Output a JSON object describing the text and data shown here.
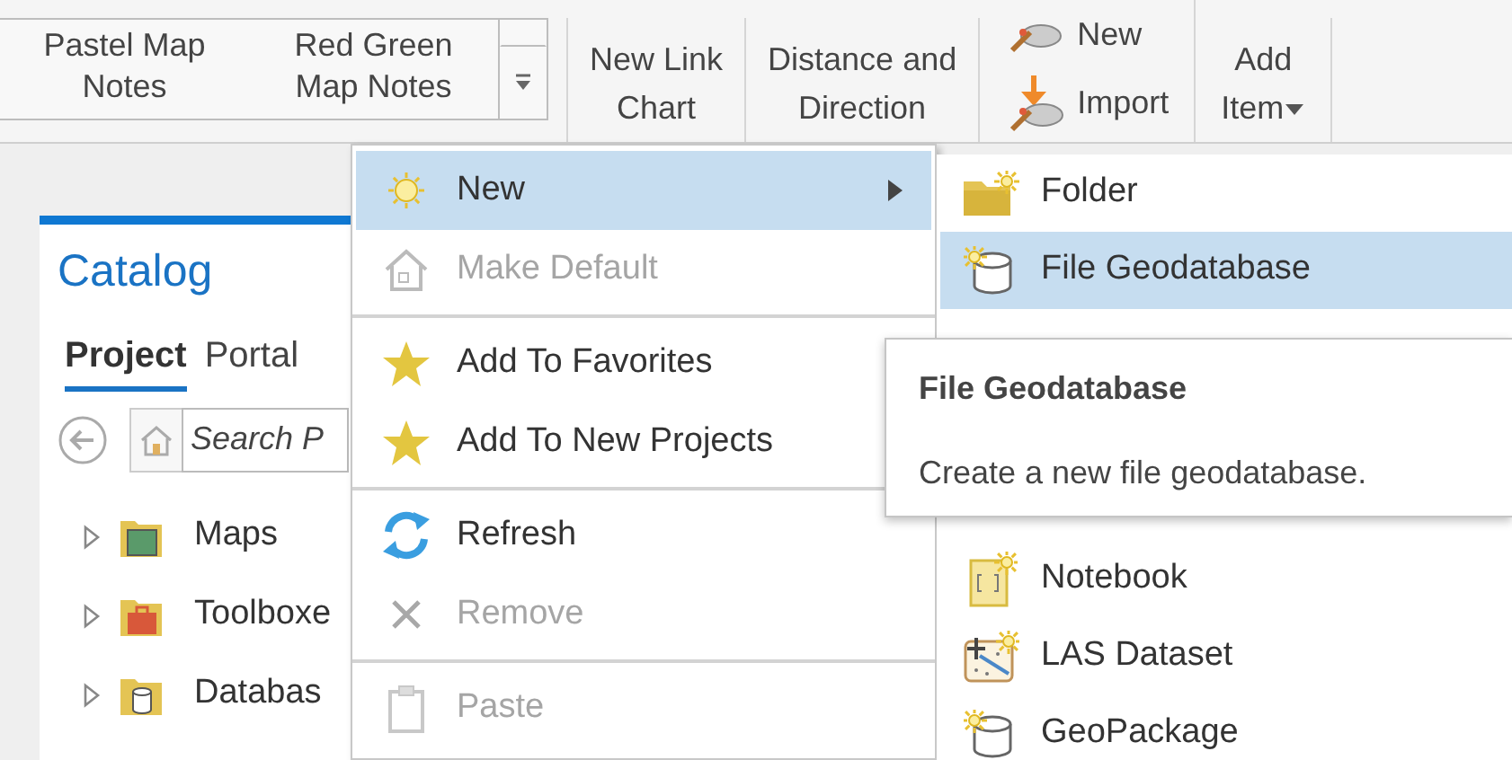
{
  "ribbon": {
    "gallery": [
      {
        "label": "Pastel Map\nNotes"
      },
      {
        "label": "Red Green\nMap Notes"
      }
    ],
    "buttons": [
      {
        "kind": "large",
        "label": "New Link\nChart"
      },
      {
        "kind": "large",
        "label": "Distance and\nDirection"
      },
      {
        "kind": "stack",
        "items": [
          {
            "label": "New",
            "kind": "pencil"
          },
          {
            "label": "Import",
            "kind": "import"
          }
        ]
      },
      {
        "kind": "dropdown",
        "label": "Add\nItem"
      }
    ]
  },
  "catalog": {
    "title": "Catalog",
    "tabs": [
      {
        "label": "Project",
        "selected": true
      },
      {
        "label": "Portal",
        "selected": false
      }
    ],
    "search": {
      "placeholder": "Search P"
    },
    "tree": [
      {
        "label": "Maps",
        "kind": "maps",
        "expanded": false
      },
      {
        "label": "Toolboxe",
        "kind": "toolbox",
        "expanded": false
      },
      {
        "label": "Databas",
        "kind": "database",
        "expanded": false
      }
    ]
  },
  "context_menu": {
    "groups": [
      [
        {
          "label": "New",
          "kind": "sun",
          "selected": true,
          "disabled": false,
          "submenu": true
        },
        {
          "label": "Make Default",
          "kind": "house",
          "selected": false,
          "disabled": true,
          "submenu": false
        }
      ],
      [
        {
          "label": "Add To Favorites",
          "kind": "star",
          "selected": false,
          "disabled": false,
          "submenu": false
        },
        {
          "label": "Add To New Projects",
          "kind": "star",
          "selected": false,
          "disabled": false,
          "submenu": false
        }
      ],
      [
        {
          "label": "Refresh",
          "kind": "refresh",
          "selected": false,
          "disabled": false,
          "submenu": false
        },
        {
          "label": "Remove",
          "kind": "x",
          "selected": false,
          "disabled": true,
          "submenu": false
        }
      ],
      [
        {
          "label": "Paste",
          "kind": "paste",
          "selected": false,
          "disabled": true,
          "submenu": false
        }
      ]
    ]
  },
  "submenu": {
    "items_top": [
      {
        "label": "Folder",
        "kind": "folder-new",
        "selected": false
      },
      {
        "label": "File Geodatabase",
        "kind": "db-new",
        "selected": true
      }
    ],
    "items_bottom": [
      {
        "label": "Notebook",
        "kind": "notebook",
        "selected": false
      },
      {
        "label": "LAS Dataset",
        "kind": "las",
        "selected": false
      },
      {
        "label": "GeoPackage",
        "kind": "db-new",
        "selected": false
      }
    ]
  },
  "tooltip": {
    "title": "File Geodatabase",
    "text": "Create a new file geodatabase."
  }
}
